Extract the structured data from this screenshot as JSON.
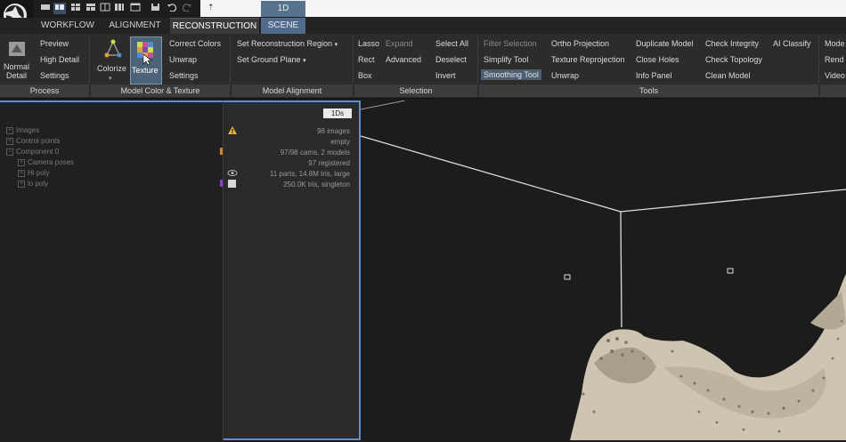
{
  "toolbar": {
    "search_text": "⇡"
  },
  "tabs": [
    {
      "label": "WORKFLOW"
    },
    {
      "label": "ALIGNMENT"
    },
    {
      "label": "RECONSTRUCTION"
    },
    {
      "label": "SCENE"
    },
    {
      "label": "1D"
    }
  ],
  "ribbon": {
    "process": {
      "normal_detail": "Normal\nDetail",
      "preview": "Preview",
      "high_detail": "High Detail",
      "settings": "Settings",
      "group": "Process"
    },
    "color": {
      "colorize": "Colorize",
      "texture": "Texture",
      "correct_colors": "Correct Colors",
      "unwrap": "Unwrap",
      "settings": "Settings",
      "group": "Model Color & Texture"
    },
    "alignment": {
      "set_region": "Set Reconstruction Region",
      "set_ground": "Set Ground Plane",
      "group": "Model Alignment"
    },
    "selection": {
      "lasso": "Lasso",
      "expand": "Expand",
      "rect": "Rect",
      "advanced": "Advanced",
      "box": "Box",
      "select_all": "Select All",
      "deselect": "Deselect",
      "invert": "Invert",
      "group": "Selection"
    },
    "tools": {
      "filter_selection": "Filter Selection",
      "simplify": "Simplify Tool",
      "smoothing": "Smoothing Tool",
      "ortho": "Ortho Projection",
      "reprojection": "Texture Reprojection",
      "unwrap": "Unwrap",
      "duplicate": "Duplicate Model",
      "close_holes": "Close Holes",
      "info_panel": "Info Panel",
      "check_integrity": "Check Integrity",
      "check_topology": "Check Topology",
      "clean_model": "Clean Model",
      "ai_classify": "AI Classify",
      "group": "Tools"
    },
    "extra": {
      "mode": "Mode",
      "rend": "Rend",
      "video": "Video"
    }
  },
  "tree": [
    "Images",
    "Control points",
    "Component 0",
    "Camera poses",
    "Hi poly",
    "lo poly"
  ],
  "props": {
    "badge": "1Ds",
    "rows": [
      "98 images",
      "empty",
      "97/98 cams, 2 models",
      "97 registered",
      "11 parts, 14.8M tris, large",
      "250.0K tris, singleton"
    ]
  },
  "colors": {
    "accent": "#5d8fd0",
    "active_tab": "#4f6b8d",
    "mesh": "#cdc4b2"
  }
}
